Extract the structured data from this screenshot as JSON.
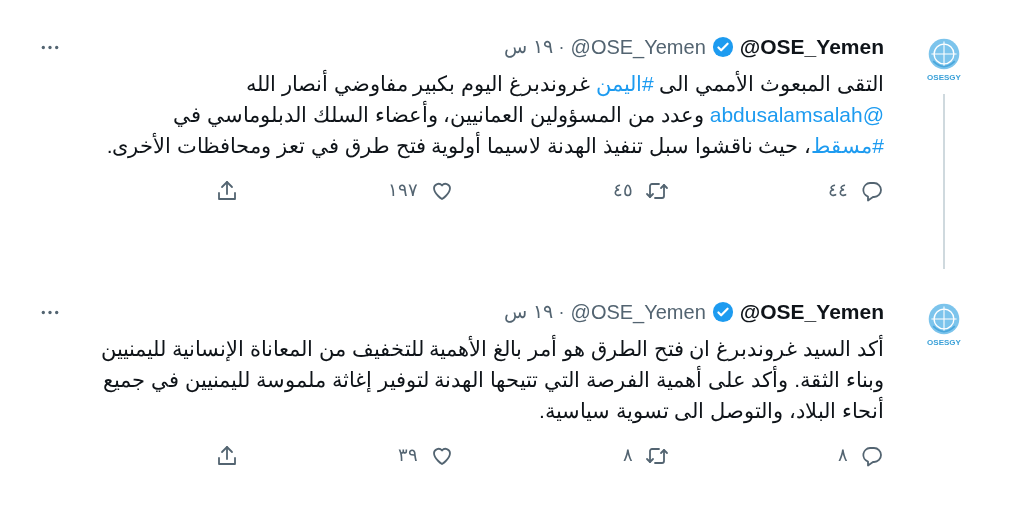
{
  "tweets": [
    {
      "avatar_label": "OSESGY",
      "name": "@OSE_Yemen",
      "verified": true,
      "handle": "@OSE_Yemen",
      "separator": "·",
      "time": "١٩ س",
      "thread_line": true,
      "body": [
        {
          "kind": "plain",
          "text": "التقى المبعوث الأممي الى "
        },
        {
          "kind": "link",
          "text": "#اليمن"
        },
        {
          "kind": "plain",
          "text": " غروندبرغ اليوم بكبير مفاوضي أنصار الله "
        },
        {
          "kind": "link",
          "text": "@abdusalamsalah"
        },
        {
          "kind": "plain",
          "text": " وعدد من المسؤولين العمانيين، وأعضاء السلك الدبلوماسي في "
        },
        {
          "kind": "link",
          "text": "#مسقط"
        },
        {
          "kind": "plain",
          "text": "، حيث ناقشوا سبل تنفيذ الهدنة لاسيما أولوية فتح طرق في تعز ومحافظات الأخرى."
        }
      ],
      "replies": "٤٤",
      "retweets": "٤٥",
      "likes": "١٩٧"
    },
    {
      "avatar_label": "OSESGY",
      "name": "@OSE_Yemen",
      "verified": true,
      "handle": "@OSE_Yemen",
      "separator": "·",
      "time": "١٩ س",
      "thread_line": false,
      "body": [
        {
          "kind": "plain",
          "text": "أكد السيد غروندبرغ ان فتح الطرق هو أمر بالغ الأهمية للتخفيف من المعاناة الإنسانية لليمنيين وبناء الثقة. وأكد على أهمية الفرصة التي تتيحها الهدنة لتوفير إغاثة ملموسة لليمنيين في جميع أنحاء البلاد، والتوصل الى تسوية سياسية."
        }
      ],
      "replies": "٨",
      "retweets": "٨",
      "likes": "٣٩"
    }
  ]
}
